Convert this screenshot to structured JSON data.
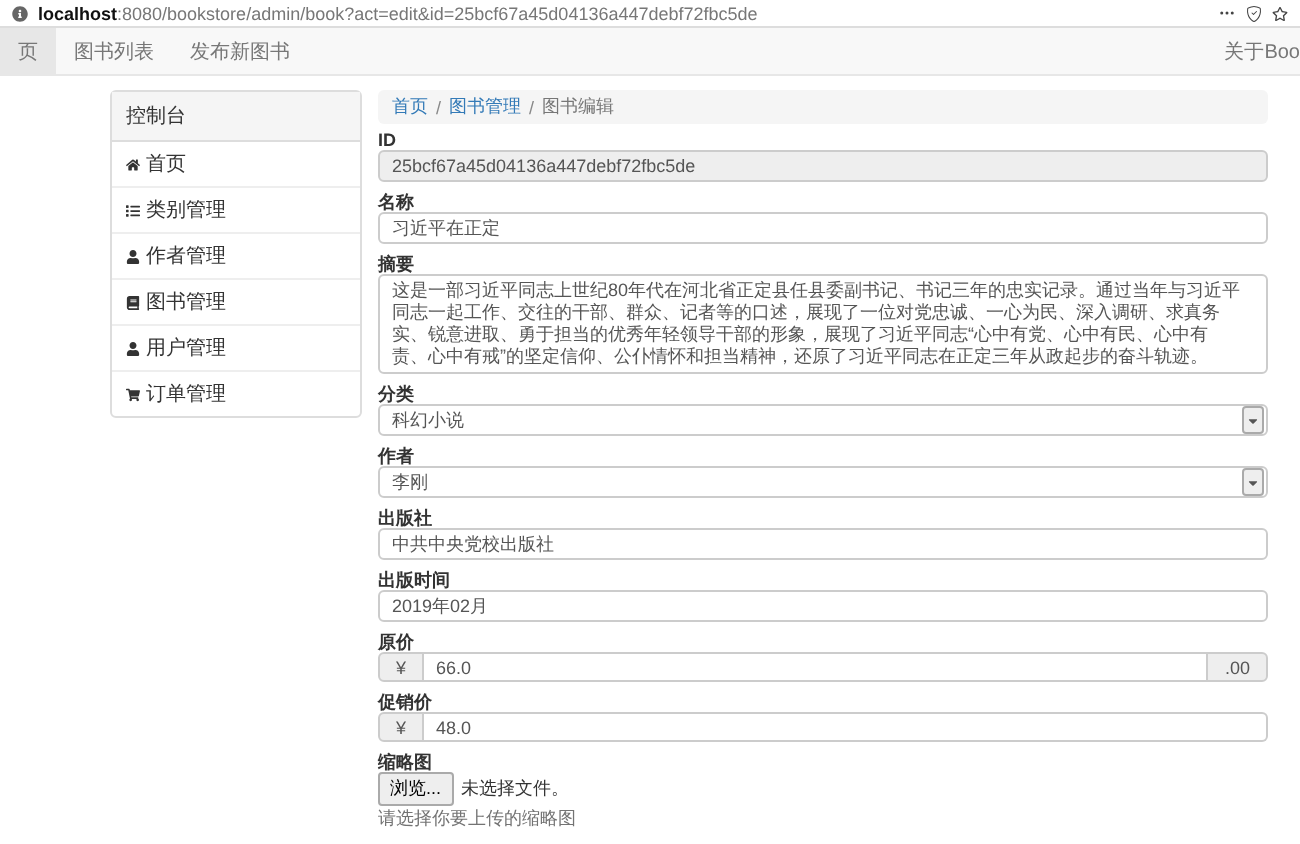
{
  "browser": {
    "url": "**localhost**:8080/bookstore/admin/book?act=edit&id=25bcf67a45d04136a447debf72fbc5de"
  },
  "navbar": {
    "items": [
      {
        "label": "页",
        "selected": true
      },
      {
        "label": "图书列表",
        "selected": false
      },
      {
        "label": "发布新图书",
        "selected": false
      }
    ],
    "right_link": "关于Boo"
  },
  "sidebar": {
    "title": "控制台",
    "items": [
      {
        "kind": "home",
        "label": "首页"
      },
      {
        "kind": "list",
        "label": "类别管理"
      },
      {
        "kind": "user",
        "label": "作者管理"
      },
      {
        "kind": "book",
        "label": "图书管理"
      },
      {
        "kind": "user",
        "label": "用户管理"
      },
      {
        "kind": "cart",
        "label": "订单管理"
      }
    ]
  },
  "breadcrumb_separator": "/",
  "breadcrumb": [
    {
      "label": "首页",
      "link": true
    },
    {
      "label": "图书管理",
      "link": true
    },
    {
      "label": "图书编辑",
      "link": false
    }
  ],
  "form": [
    {
      "kind": "readonly",
      "label": "ID",
      "value": "25bcf67a45d04136a447debf72fbc5de"
    },
    {
      "kind": "text",
      "label": "名称",
      "value": "习近平在正定"
    },
    {
      "kind": "textarea",
      "label": "摘要",
      "value": "这是一部习近平同志上世纪80年代在河北省正定县任县委副书记、书记三年的忠实记录。通过当年与习近平同志一起工作、交往的干部、群众、记者等的口述，展现了一位对党忠诚、一心为民、深入调研、求真务实、锐意进取、勇于担当的优秀年轻领导干部的形象，展现了习近平同志“心中有党、心中有民、心中有责、心中有戒”的坚定信仰、公仆情怀和担当精神，还原了习近平同志在正定三年从政起步的奋斗轨迹。"
    },
    {
      "kind": "select",
      "label": "分类",
      "value": "科幻小说"
    },
    {
      "kind": "select",
      "label": "作者",
      "value": "李刚"
    },
    {
      "kind": "text",
      "label": "出版社",
      "value": "中共中央党校出版社"
    },
    {
      "kind": "text",
      "label": "出版时间",
      "value": "2019年02月"
    },
    {
      "kind": "money",
      "label": "原价",
      "input": {
        "prefix": "¥",
        "amount": "66.0",
        "suffix": ".00"
      }
    },
    {
      "kind": "money",
      "label": "促销价",
      "input": {
        "prefix": "¥",
        "amount": "48.0"
      }
    },
    {
      "kind": "file",
      "label": "缩略图",
      "button": "浏览...",
      "status": "未选择文件。",
      "hint": "请选择你要上传的缩略图"
    }
  ]
}
